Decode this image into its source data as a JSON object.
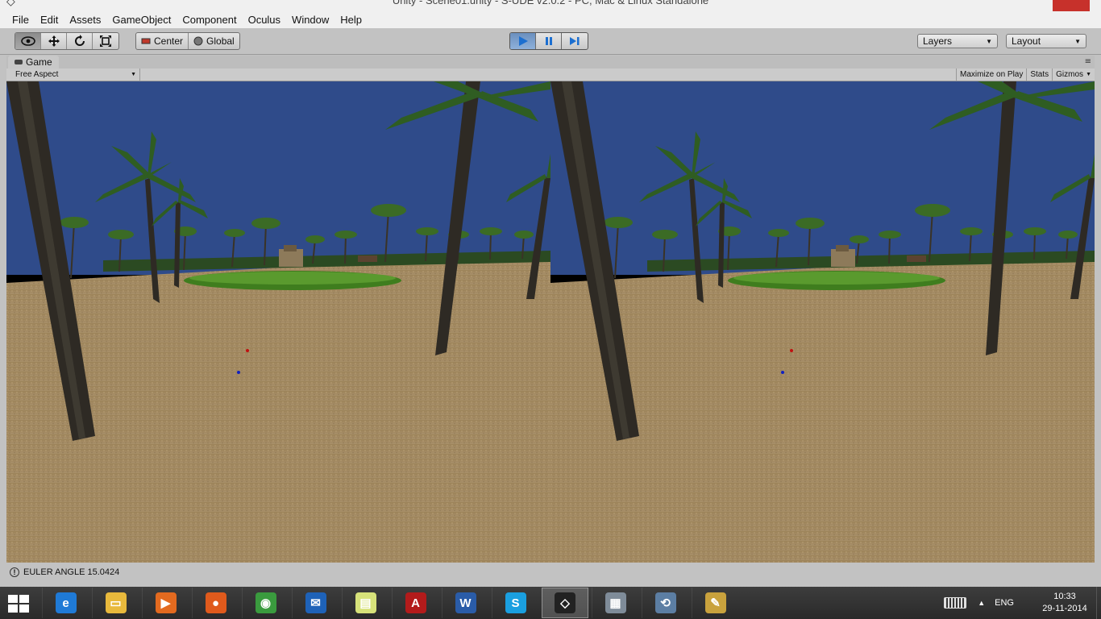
{
  "window": {
    "title": "Unity - Scene01.unity - S-UDE v2.0.2 - PC, Mac & Linux Standalone"
  },
  "menu": [
    "File",
    "Edit",
    "Assets",
    "GameObject",
    "Component",
    "Oculus",
    "Window",
    "Help"
  ],
  "toolbar": {
    "tools": [
      "eye-icon",
      "move-icon",
      "rotate-icon",
      "scale-icon"
    ],
    "pivot_label": "Center",
    "space_label": "Global",
    "playback": [
      "play-icon",
      "pause-icon",
      "step-icon"
    ],
    "layers_label": "Layers",
    "layout_label": "Layout"
  },
  "game_panel": {
    "tab_label": "Game",
    "aspect_label": "Free Aspect",
    "maximize_label": "Maximize on Play",
    "stats_label": "Stats",
    "gizmos_label": "Gizmos"
  },
  "status": {
    "message": "EULER ANGLE 15.0424"
  },
  "taskbar": {
    "apps": [
      {
        "name": "internet-explorer",
        "color": "#1f7ad6",
        "glyph": "e"
      },
      {
        "name": "file-explorer",
        "color": "#e8b93c",
        "glyph": "▭"
      },
      {
        "name": "media-player",
        "color": "#e36a1f",
        "glyph": "▶"
      },
      {
        "name": "firefox",
        "color": "#e05a1c",
        "glyph": "●"
      },
      {
        "name": "chrome",
        "color": "#3a9b3e",
        "glyph": "◉"
      },
      {
        "name": "mail",
        "color": "#1e62b8",
        "glyph": "✉"
      },
      {
        "name": "sticky-notes",
        "color": "#d7e27a",
        "glyph": "▤"
      },
      {
        "name": "acrobat",
        "color": "#b31b1b",
        "glyph": "A"
      },
      {
        "name": "word",
        "color": "#2a5ca8",
        "glyph": "W"
      },
      {
        "name": "skype",
        "color": "#1a9fe0",
        "glyph": "S"
      },
      {
        "name": "unity",
        "color": "#222222",
        "glyph": "◇"
      },
      {
        "name": "monitor",
        "color": "#7f8c99",
        "glyph": "▦"
      },
      {
        "name": "remote",
        "color": "#5c7ea3",
        "glyph": "⟲"
      },
      {
        "name": "paint",
        "color": "#c9a23d",
        "glyph": "✎"
      }
    ],
    "language": "ENG",
    "time": "10:33",
    "date": "29-11-2014"
  },
  "colors": {
    "sky": "#2f4b8a",
    "sand": "#a7895f",
    "grass": "#3f7d1e",
    "trunk": "#2e2a24",
    "frond": "#2f5d22",
    "play_active": "#1c6fd0"
  }
}
